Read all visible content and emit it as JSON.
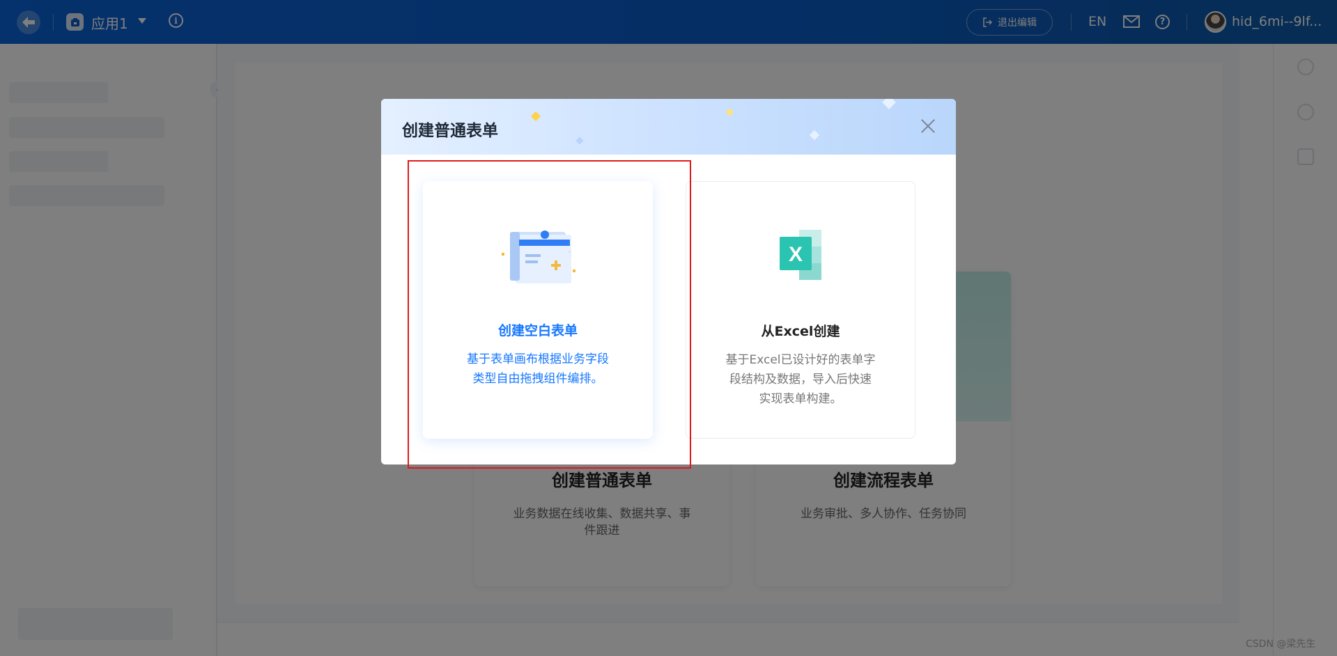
{
  "topbar": {
    "app_name": "应用1",
    "exit_edit_label": "退出编辑",
    "lang_label": "EN",
    "username": "hid_6mi--9lf..."
  },
  "background": {
    "cards": [
      {
        "title": "创建普通表单",
        "desc": "业务数据在线收集、数据共享、事件跟进"
      },
      {
        "title": "创建流程表单",
        "desc": "业务审批、多人协作、任务协同"
      }
    ]
  },
  "modal": {
    "title": "创建普通表单",
    "options": [
      {
        "title": "创建空白表单",
        "desc": "基于表单画布根据业务字段类型自由拖拽组件编排。",
        "icon": "blank-form-icon"
      },
      {
        "title": "从Excel创建",
        "desc": "基于Excel已设计好的表单字段结构及数据，导入后快速实现表单构建。",
        "icon": "excel-icon"
      }
    ]
  },
  "watermark": "CSDN @梁先生",
  "colors": {
    "topbar": "#0a63d8",
    "accent": "#1677ff",
    "excel_green": "#2bc4b0",
    "highlight": "#e0191b"
  }
}
